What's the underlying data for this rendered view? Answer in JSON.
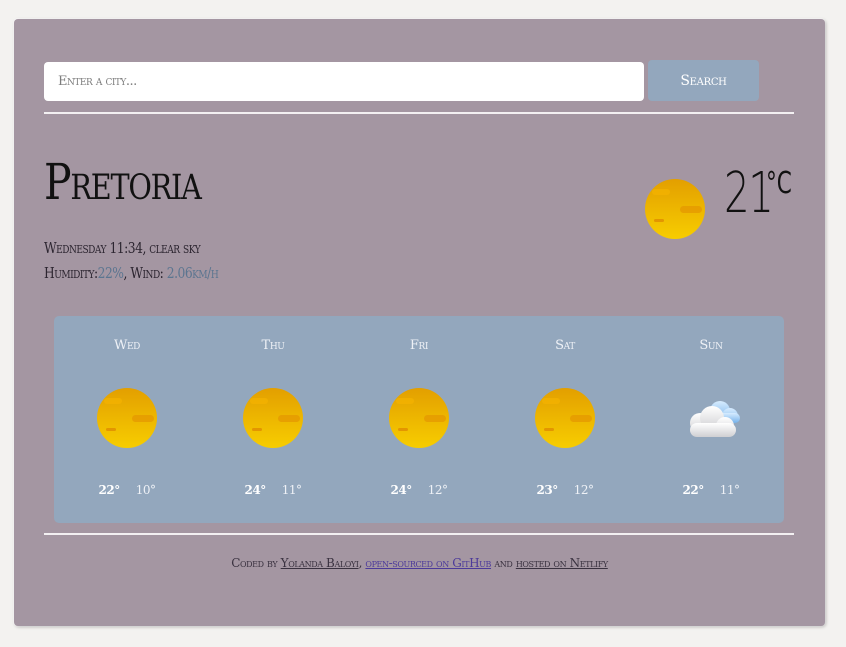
{
  "search": {
    "placeholder": "Enter a city...",
    "button_label": "Search"
  },
  "current": {
    "city": "Pretoria",
    "day_time": "Wednesday 11:34",
    "description": ", clear sky",
    "humidity_label": "Humidity:",
    "humidity_value": "22%",
    "wind_label": ", Wind: ",
    "wind_value": "2.06km/h",
    "temperature": "21",
    "unit": "°C",
    "icon": "sun-icon"
  },
  "forecast": [
    {
      "day": "Wed",
      "max": "22°",
      "min": "10°",
      "icon": "sun-icon"
    },
    {
      "day": "Thu",
      "max": "24°",
      "min": "11°",
      "icon": "sun-icon"
    },
    {
      "day": "Fri",
      "max": "24°",
      "min": "12°",
      "icon": "sun-icon"
    },
    {
      "day": "Sat",
      "max": "23°",
      "min": "12°",
      "icon": "sun-icon"
    },
    {
      "day": "Sun",
      "max": "22°",
      "min": "11°",
      "icon": "cloud-icon"
    }
  ],
  "footer": {
    "prefix": "Coded by ",
    "author": "Yolanda Baloyi",
    "sep": ", ",
    "source_link": "open-sourced on GitHub",
    "and": " and ",
    "hosting_link": "hosted on Netlify"
  },
  "colors": {
    "panel": "#a496a2",
    "forecast_bg": "#93a7bd",
    "button_bg": "#93a7bd",
    "accent_text": "#5b7590",
    "link": "#4c3a9a",
    "sun": "#f2b800"
  }
}
